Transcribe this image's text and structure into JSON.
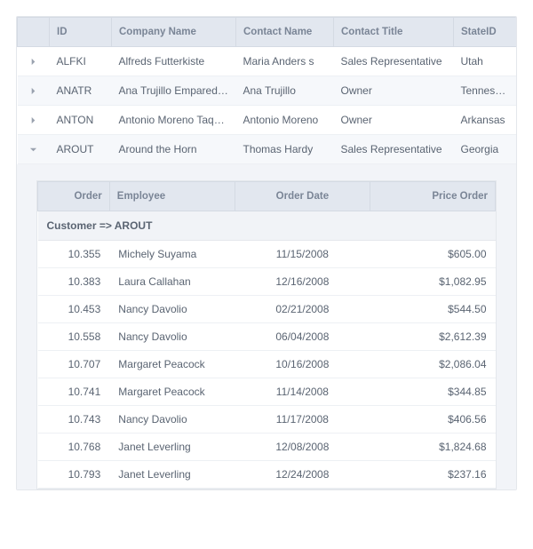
{
  "mainGrid": {
    "columns": [
      "ID",
      "Company Name",
      "Contact Name",
      "Contact Title",
      "StateID"
    ],
    "rows": [
      {
        "expanded": false,
        "id": "ALFKI",
        "company": "Alfreds Futterkiste",
        "contact": "Maria Anders s",
        "title": "Sales Representative",
        "state": "Utah"
      },
      {
        "expanded": false,
        "id": "ANATR",
        "company": "Ana Trujillo Emparedados",
        "contact": "Ana Trujillo",
        "title": "Owner",
        "state": "Tennessee"
      },
      {
        "expanded": false,
        "id": "ANTON",
        "company": "Antonio Moreno Taquerilla",
        "contact": "Antonio Moreno",
        "title": "Owner",
        "state": "Arkansas"
      },
      {
        "expanded": true,
        "id": "AROUT",
        "company": "Around the Horn",
        "contact": "Thomas Hardy",
        "title": "Sales Representative",
        "state": "Georgia"
      }
    ]
  },
  "detailGrid": {
    "columns": [
      "Order",
      "Employee",
      "Order Date",
      "Price Order"
    ],
    "groupLabel": "Customer => AROUT",
    "rows": [
      {
        "order": "10.355",
        "employee": "Michely Suyama",
        "date": "11/15/2008",
        "price": "$605.00"
      },
      {
        "order": "10.383",
        "employee": "Laura Callahan",
        "date": "12/16/2008",
        "price": "$1,082.95"
      },
      {
        "order": "10.453",
        "employee": "Nancy Davolio",
        "date": "02/21/2008",
        "price": "$544.50"
      },
      {
        "order": "10.558",
        "employee": "Nancy Davolio",
        "date": "06/04/2008",
        "price": "$2,612.39"
      },
      {
        "order": "10.707",
        "employee": "Margaret Peacock",
        "date": "10/16/2008",
        "price": "$2,086.04"
      },
      {
        "order": "10.741",
        "employee": "Margaret Peacock",
        "date": "11/14/2008",
        "price": "$344.85"
      },
      {
        "order": "10.743",
        "employee": "Nancy Davolio",
        "date": "11/17/2008",
        "price": "$406.56"
      },
      {
        "order": "10.768",
        "employee": "Janet Leverling",
        "date": "12/08/2008",
        "price": "$1,824.68"
      },
      {
        "order": "10.793",
        "employee": "Janet Leverling",
        "date": "12/24/2008",
        "price": "$237.16"
      }
    ]
  }
}
